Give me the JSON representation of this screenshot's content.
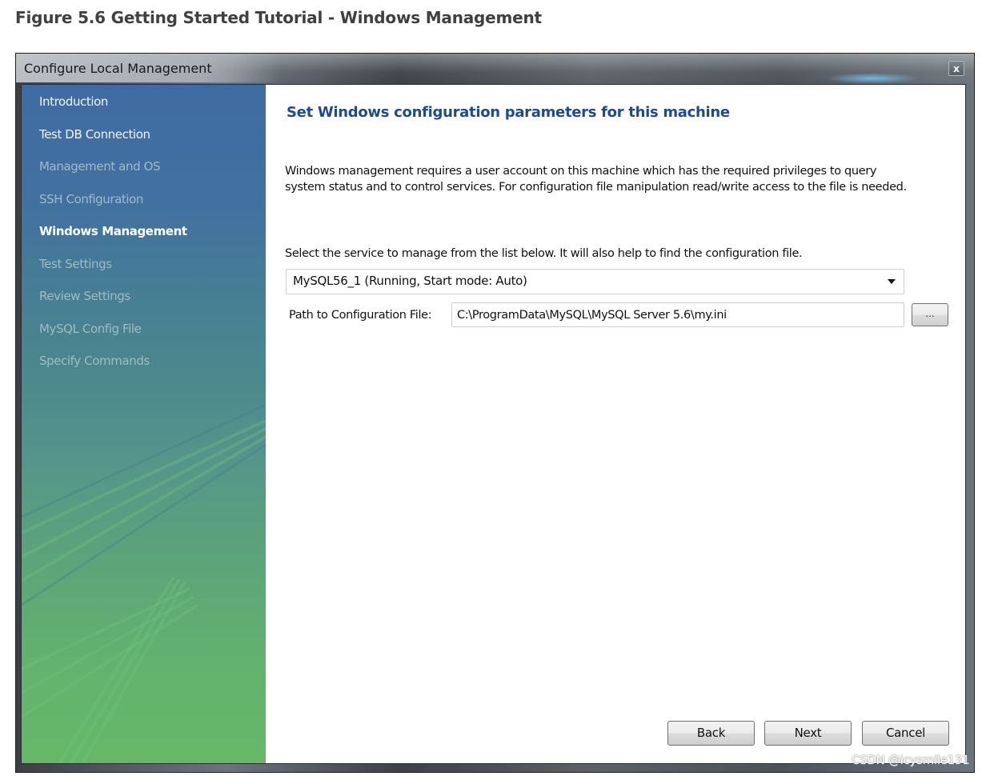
{
  "caption": "Figure 5.6 Getting Started Tutorial - Windows Management",
  "window": {
    "title": "Configure Local Management",
    "close_glyph": "x"
  },
  "sidebar": {
    "items": [
      {
        "label": "Introduction",
        "state": "done"
      },
      {
        "label": "Test DB Connection",
        "state": "done"
      },
      {
        "label": "Management and OS",
        "state": "pending"
      },
      {
        "label": "SSH Configuration",
        "state": "pending"
      },
      {
        "label": "Windows Management",
        "state": "active"
      },
      {
        "label": "Test Settings",
        "state": "pending"
      },
      {
        "label": "Review Settings",
        "state": "pending"
      },
      {
        "label": "MySQL Config File",
        "state": "pending"
      },
      {
        "label": "Specify Commands",
        "state": "pending"
      }
    ]
  },
  "main": {
    "heading": "Set Windows configuration parameters for this machine",
    "description": "Windows management requires a user account on this machine which has the required privileges to query system status and to control services. For configuration file manipulation read/write access to the file is needed.",
    "select_label": "Select the service to manage from the list below. It will also help to find the configuration file.",
    "service_selected": "MySQL56_1 (Running, Start mode: Auto)",
    "path_label": "Path to Configuration File:",
    "path_value": "C:\\ProgramData\\MySQL\\MySQL Server 5.6\\my.ini",
    "browse_label": "..."
  },
  "buttons": {
    "back": "Back",
    "next": "Next",
    "cancel": "Cancel"
  },
  "watermark": "CSDN @icysmile131",
  "colors": {
    "heading": "#1d4a96",
    "sidebar_top": "#3f6ba3",
    "sidebar_bottom": "#66b868"
  }
}
